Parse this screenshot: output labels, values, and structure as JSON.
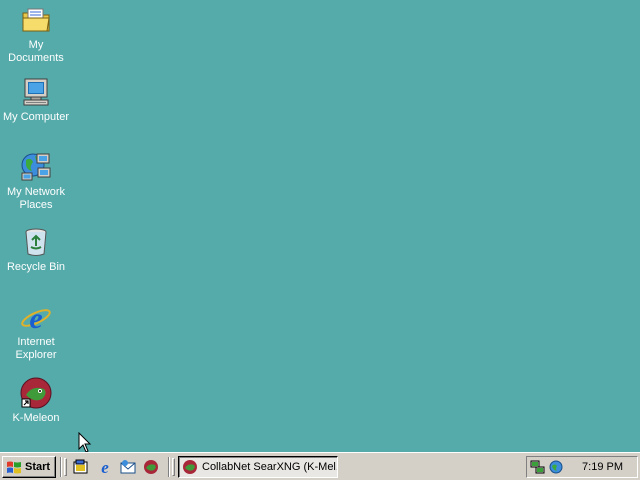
{
  "desktop": {
    "background_color": "#55aaaa",
    "icons": [
      {
        "label": "My Documents",
        "icon": "folder-documents-icon"
      },
      {
        "label": "My Computer",
        "icon": "computer-icon"
      },
      {
        "label": "My Network Places",
        "icon": "network-places-icon"
      },
      {
        "label": "Recycle Bin",
        "icon": "recycle-bin-icon"
      },
      {
        "label": "Internet Explorer",
        "icon": "internet-explorer-icon"
      },
      {
        "label": "K-Meleon",
        "icon": "k-meleon-icon"
      }
    ]
  },
  "taskbar": {
    "start_label": "Start",
    "quick_launch": [
      "show-desktop-icon",
      "internet-explorer-icon",
      "outlook-express-icon",
      "k-meleon-icon"
    ],
    "tasks": [
      {
        "label": "CollabNet SearXNG (K-Mel...",
        "icon": "k-meleon-icon"
      }
    ],
    "tray": {
      "icons": [
        "network-connection-icon",
        "volume-icon"
      ],
      "clock": "7:19 PM"
    }
  }
}
